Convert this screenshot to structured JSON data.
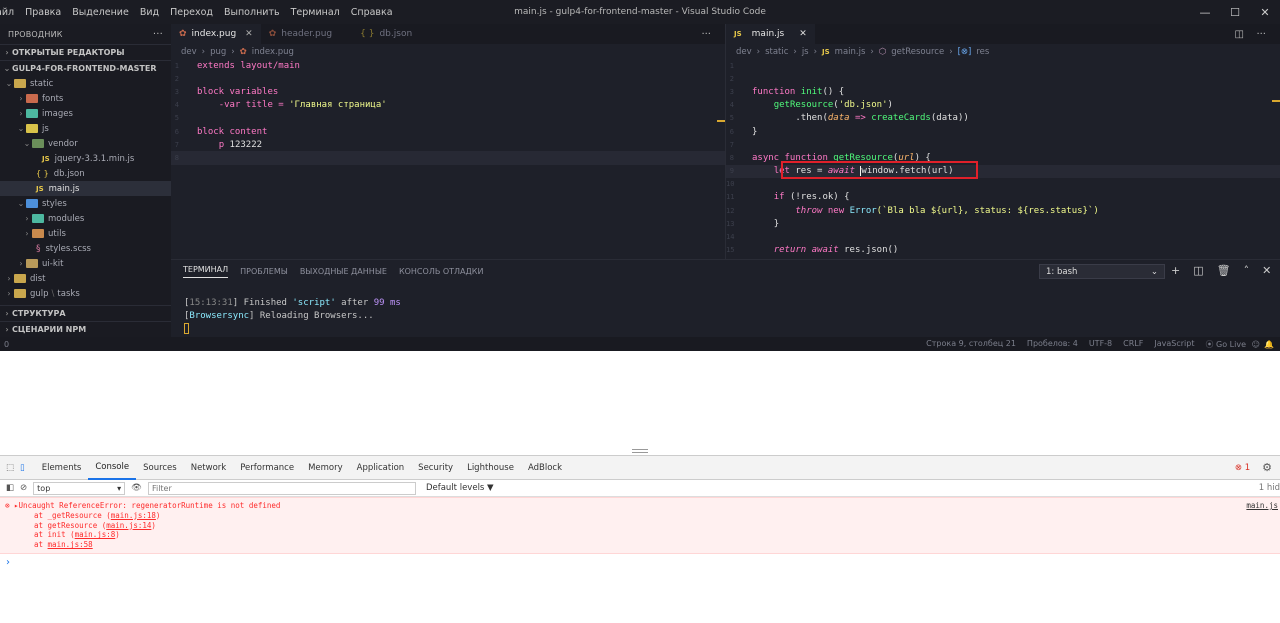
{
  "titlebar": {
    "menu": [
      "айл",
      "Правка",
      "Выделение",
      "Вид",
      "Переход",
      "Выполнить",
      "Терминал",
      "Справка"
    ],
    "title": "main.js - gulp4-for-frontend-master - Visual Studio Code",
    "controls": [
      "—",
      "☐",
      "✕"
    ]
  },
  "explorer": {
    "title": "ПРОВОДНИК",
    "more": "···",
    "open_editors": "ОТКРЫТЫЕ РЕДАКТОРЫ",
    "project": "GULP4-FOR-FRONTEND-MASTER",
    "items": [
      "static",
      "fonts",
      "images",
      "js",
      "vendor",
      "jquery-3.3.1.min.js",
      "db.json",
      "main.js",
      "styles",
      "modules",
      "utils",
      "styles.scss",
      "ui-kit",
      "dist",
      "gulp",
      "tasks"
    ],
    "outline": "СТРУКТУРА",
    "npm": "СЦЕНАРИИ NPM",
    "js_badge": "JS",
    "json_badge": "{ }"
  },
  "editor_left": {
    "tabs": [
      "index.pug",
      "header.pug",
      "db.json"
    ],
    "breadcrumb": [
      "dev",
      "pug",
      "index.pug"
    ],
    "more": "···",
    "lines": {
      "l1": "extends layout/main",
      "l3": "block variables",
      "l4a": "-var title = ",
      "l4b": "'Главная страница'",
      "l6": "block content",
      "l7a": "p",
      "l7b": " 123222"
    }
  },
  "editor_right": {
    "tab": "main.js",
    "breadcrumb": [
      "dev",
      "static",
      "js",
      "main.js",
      "getResource",
      "res"
    ],
    "lines": {
      "t_function": "function",
      "t_init": "init",
      "t_paren": "() {",
      "t_getres": "getResource",
      "t_dbjson": "'db.json'",
      "t_then": ".then(",
      "t_data": "data",
      "t_arrow": " => ",
      "t_cc": "createCards",
      "t_data2": "(data))",
      "t_close": "}",
      "t_async": "async function",
      "t_getres2": "getResource",
      "t_url": "url",
      "t_let": "let",
      "t_res": " res = ",
      "t_await": "await",
      "t_fetch": "window.fetch(url)",
      "t_if": "if",
      "t_ok": " (!res.ok) {",
      "t_throw": "throw",
      "t_new": "new",
      "t_error": "Error",
      "t_tpl": "(`Bla bla ${url}, status: ${res.status}`)",
      "t_return": "return",
      "t_json": "res.json()"
    }
  },
  "terminal": {
    "tabs": [
      "ТЕРМИНАЛ",
      "ПРОБЛЕМЫ",
      "ВЫХОДНЫЕ ДАННЫЕ",
      "КОНСОЛЬ ОТЛАДКИ"
    ],
    "shell": "1: bash",
    "line1_time": "15:13:31",
    "line1_a": "] Finished ",
    "line1_b": "'script'",
    "line1_c": " after ",
    "line1_d": "99 ms",
    "line2_a": "[",
    "line2_b": "Browsersync",
    "line2_c": "] Reloading Browsers...",
    "line1_open": "["
  },
  "status": {
    "left": "0",
    "right": [
      "Строка 9, столбец 21",
      "Пробелов: 4",
      "UTF-8",
      "CRLF",
      "JavaScript",
      "Go Live"
    ]
  },
  "devtools": {
    "tabs": [
      "Elements",
      "Console",
      "Sources",
      "Network",
      "Performance",
      "Memory",
      "Application",
      "Security",
      "Lighthouse",
      "AdBlock"
    ],
    "error_count": "1",
    "context": "top",
    "filter_placeholder": "Filter",
    "levels": "Default levels ▼",
    "hidden": "1 hid",
    "error_msg": "Uncaught ReferenceError: regeneratorRuntime is not defined",
    "stack": [
      {
        "fn": "at _getResource (",
        "loc": "main.js:18",
        "end": ")"
      },
      {
        "fn": "at getResource (",
        "loc": "main.js:14",
        "end": ")"
      },
      {
        "fn": "at init (",
        "loc": "main.js:8",
        "end": ")"
      },
      {
        "fn": "at ",
        "loc": "main.js:58",
        "end": ""
      }
    ],
    "source_link": "main.js",
    "prompt": "›"
  },
  "colors": {
    "accent": "#1a73e8",
    "highlight_box": "#e0202a",
    "editor_bg": "#1e2029"
  }
}
